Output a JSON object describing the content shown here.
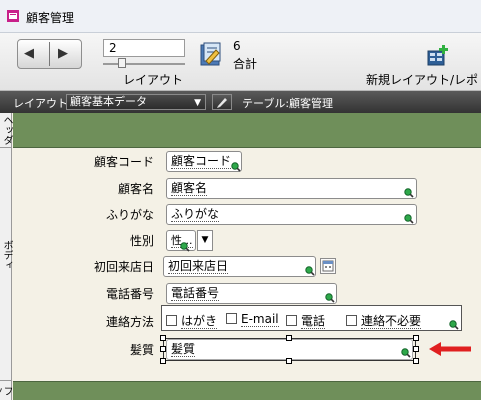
{
  "window": {
    "title": "顧客管理"
  },
  "toolbar": {
    "record_field_value": "2",
    "mode_label": "レイアウト",
    "total_count": "6",
    "total_label": "合計",
    "new_layout_label": "新規レイアウト/レポ"
  },
  "layout_bar": {
    "layout_label": "レイアウト:",
    "layout_selected": "顧客基本データ",
    "table_label": "テーブル:顧客管理"
  },
  "parts": {
    "header": "ヘッダ",
    "body": "ボディ",
    "footer": "フッタ"
  },
  "fields": {
    "customer_code": {
      "label": "顧客コード",
      "value": "顧客コード"
    },
    "customer_name": {
      "label": "顧客名",
      "value": "顧客名"
    },
    "furigana": {
      "label": "ふりがな",
      "value": "ふりがな"
    },
    "gender": {
      "label": "性別",
      "value": "性..."
    },
    "first_visit": {
      "label": "初回来店日",
      "value": "初回来店日"
    },
    "phone": {
      "label": "電話番号",
      "value": "電話番号"
    },
    "contact": {
      "label": "連絡方法",
      "options": [
        "はがき",
        "E-mail",
        "電話",
        "連絡不必要"
      ]
    },
    "hair": {
      "label": "髪質",
      "value": "髪質"
    }
  },
  "colors": {
    "part_band": "#6f8f5a",
    "canvas": "#f4f1e6",
    "arrow": "#e02020",
    "magnifier": "#2ea84a"
  }
}
